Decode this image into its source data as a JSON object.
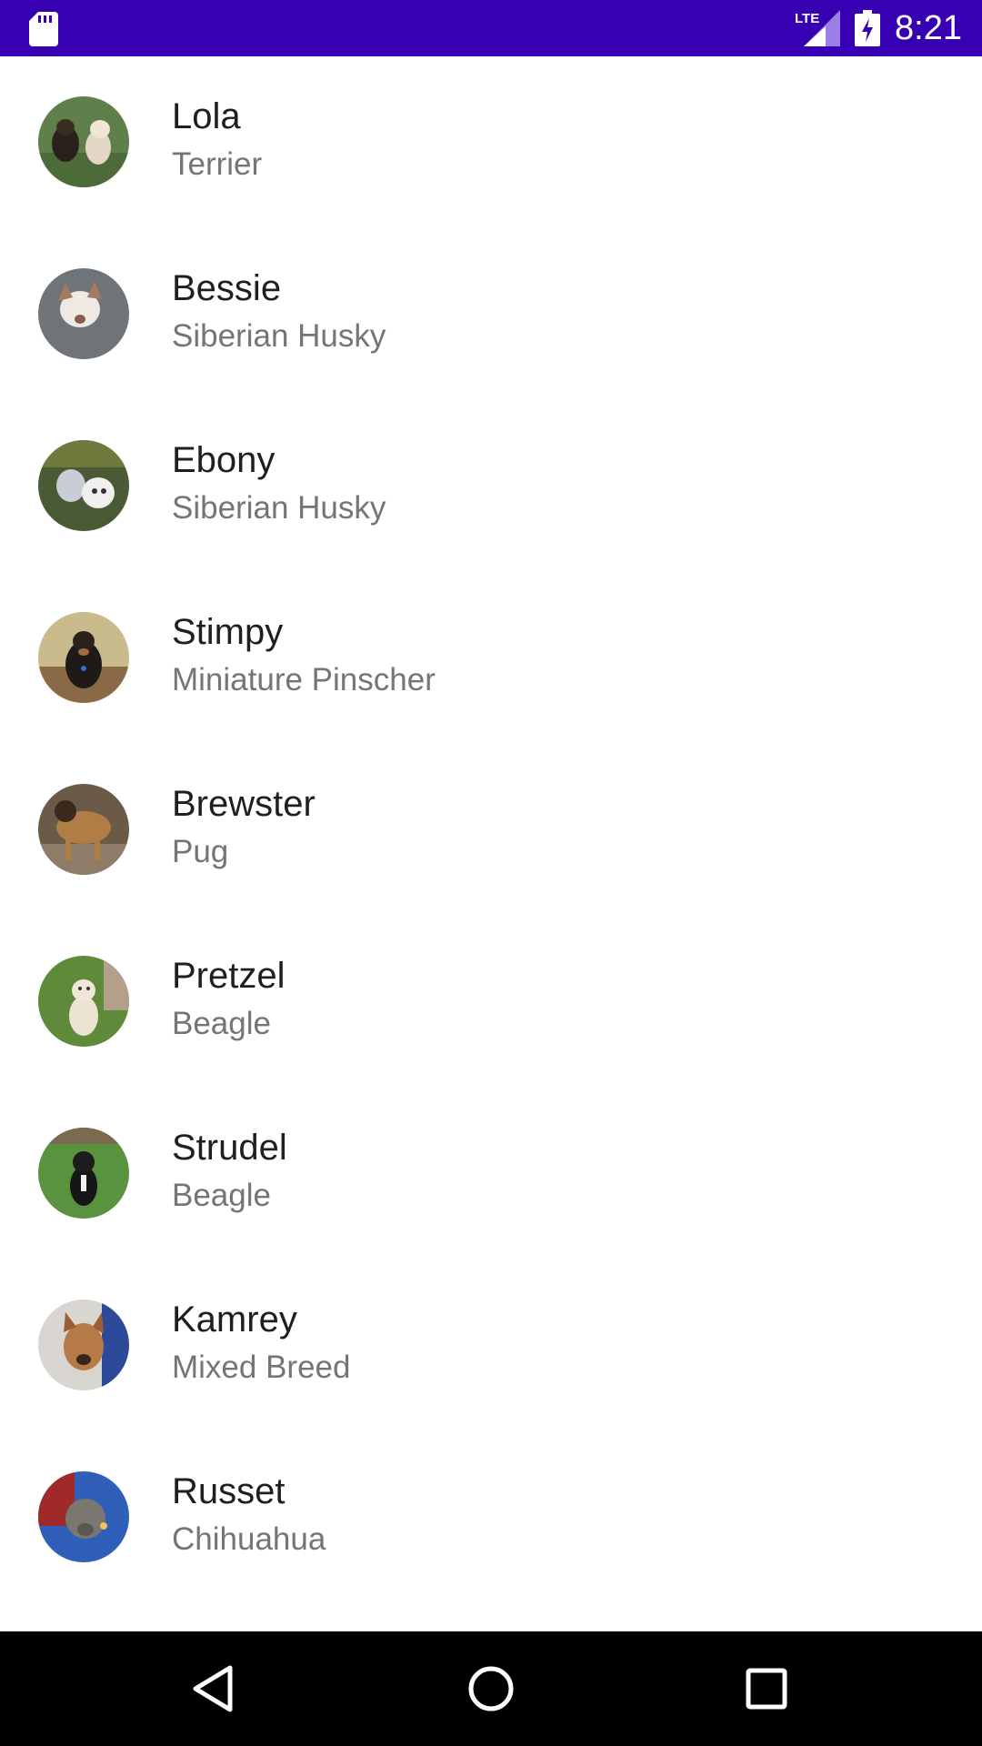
{
  "status_bar": {
    "time": "8:21",
    "network_label": "LTE",
    "icons": [
      "sd-card-icon",
      "lte-signal-icon",
      "battery-charging-icon"
    ],
    "background_color": "#3700b3"
  },
  "dogs": [
    {
      "name": "Lola",
      "breed": "Terrier"
    },
    {
      "name": "Bessie",
      "breed": "Siberian Husky"
    },
    {
      "name": "Ebony",
      "breed": "Siberian Husky"
    },
    {
      "name": "Stimpy",
      "breed": "Miniature Pinscher"
    },
    {
      "name": "Brewster",
      "breed": "Pug"
    },
    {
      "name": "Pretzel",
      "breed": "Beagle"
    },
    {
      "name": "Strudel",
      "breed": "Beagle"
    },
    {
      "name": "Kamrey",
      "breed": "Mixed Breed"
    },
    {
      "name": "Russet",
      "breed": "Chihuahua"
    }
  ],
  "nav_bar": {
    "buttons": [
      "back-icon",
      "home-icon",
      "recents-icon"
    ]
  }
}
